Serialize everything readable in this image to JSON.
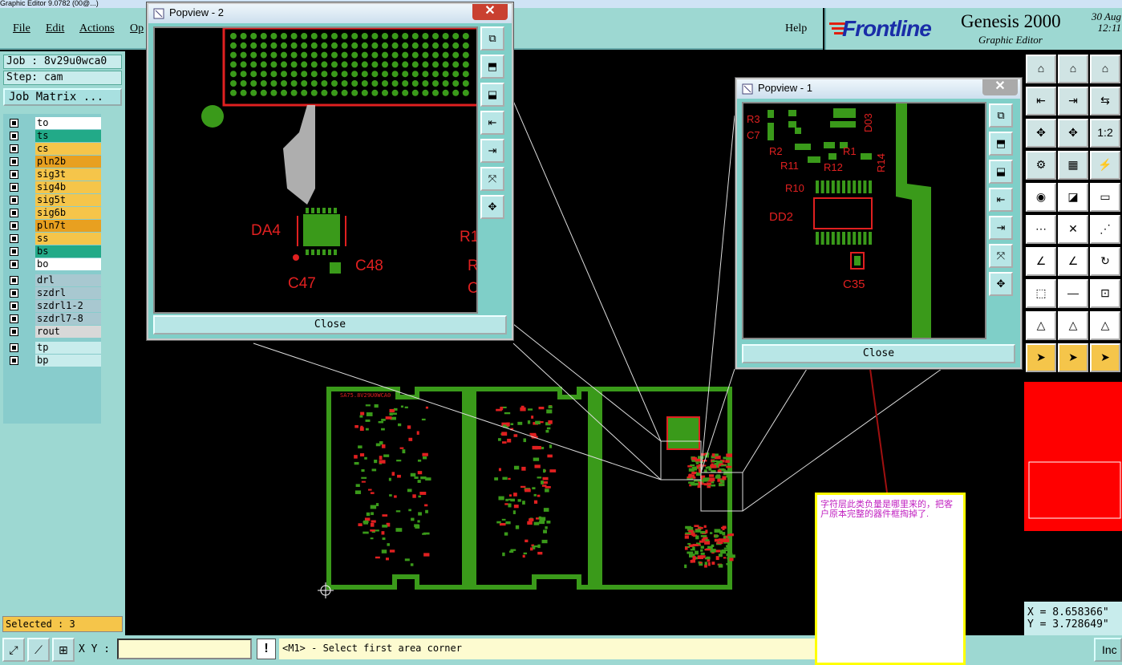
{
  "window_title": "Graphic Editor 9.0782 (00@...)",
  "menu": {
    "file": "File",
    "edit": "Edit",
    "actions": "Actions",
    "op": "Op",
    "help": "Help"
  },
  "logo": {
    "brand": "Frontline",
    "product": "Genesis 2000",
    "subtitle": "Graphic Editor",
    "date": "30 Aug",
    "time": "12:11"
  },
  "job": {
    "job_label": "Job : 8v29u0wca0",
    "step_label": "Step: cam",
    "matrix_button": "Job Matrix ..."
  },
  "layers": [
    {
      "name": "to",
      "color": "#ffffff",
      "active": true
    },
    {
      "name": "ts",
      "color": "#22aa88"
    },
    {
      "name": "cs",
      "color": "#f5c54a"
    },
    {
      "name": "pln2b",
      "color": "#e8a020"
    },
    {
      "name": "sig3t",
      "color": "#f5c54a"
    },
    {
      "name": "sig4b",
      "color": "#f5c54a"
    },
    {
      "name": "sig5t",
      "color": "#f5c54a"
    },
    {
      "name": "sig6b",
      "color": "#f5c54a"
    },
    {
      "name": "pln7t",
      "color": "#e8a020"
    },
    {
      "name": "ss",
      "color": "#f5c54a"
    },
    {
      "name": "bs",
      "color": "#22aa88"
    },
    {
      "name": "bo",
      "color": "#ffffff"
    }
  ],
  "drill_layers": [
    {
      "name": "drl",
      "color": "#a8c8d0"
    },
    {
      "name": "szdrl",
      "color": "#a8c8d0"
    },
    {
      "name": "szdrl1-2",
      "color": "#a8c8d0"
    },
    {
      "name": "szdrl7-8",
      "color": "#a8c8d0"
    },
    {
      "name": "rout",
      "color": "#d8d8d8"
    }
  ],
  "extra_layers": [
    {
      "name": "tp",
      "color": "#c8ecec"
    },
    {
      "name": "bp",
      "color": "#c8ecec"
    }
  ],
  "selected": "Selected : 3",
  "statusbar": {
    "xy_label": "X Y :",
    "xy_value": "",
    "prompt": "<M1> - Select first area corner",
    "inc": "Inc"
  },
  "coords": {
    "x": "X = 8.658366\"",
    "y": "Y = 3.728649\""
  },
  "popview2": {
    "title": "Popview - 2",
    "close": "Close",
    "labels": {
      "da4": "DA4",
      "c48": "C48",
      "c47": "C47",
      "r1": "R1",
      "r": "R",
      "c": "C"
    }
  },
  "popview1": {
    "title": "Popview - 1",
    "close": "Close",
    "labels": {
      "r3": "R3",
      "c7": "C7",
      "r2": "R2",
      "r1": "R1",
      "r11": "R11",
      "r12": "R12",
      "r14": "R14",
      "r10": "R10",
      "dd2": "DD2",
      "c35": "C35",
      "d03": "D03"
    }
  },
  "note": "字符层此类负量是哪里来的，把客户原本完整的器件框掏掉了.",
  "board_text": "SA75.8V29U0WCA0",
  "colors": {
    "panel": "#9dd8d2",
    "board": "#3a9a1a",
    "silk": "#e02020",
    "note_text": "#c020c0"
  }
}
